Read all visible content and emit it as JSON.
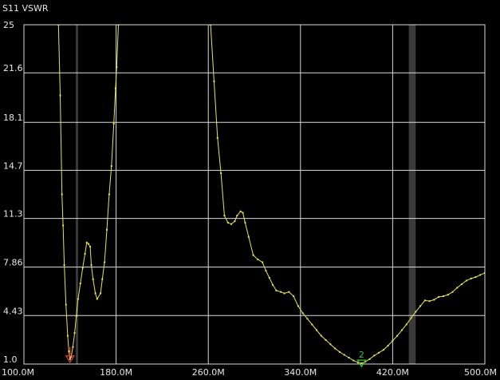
{
  "window": {
    "title": "S11 VSWR"
  },
  "colors": {
    "background": "#000000",
    "grid": "#d9d9d9",
    "axis_text": "#e6e6e6",
    "trace": "#e8e35a",
    "band": "#3a3a3a",
    "marker1": "#e03a3a",
    "marker2": "#3cbe3c"
  },
  "chart_data": {
    "type": "line",
    "title": "S11 VSWR",
    "xlabel": "",
    "ylabel": "",
    "x_unit": "Hz",
    "xlim": [
      100000000,
      500000000
    ],
    "ylim": [
      1.0,
      25
    ],
    "x_ticks": [
      {
        "value": 100000000,
        "label": "100.0M"
      },
      {
        "value": 180000000,
        "label": "180.0M"
      },
      {
        "value": 260000000,
        "label": "260.0M"
      },
      {
        "value": 340000000,
        "label": "340.0M"
      },
      {
        "value": 420000000,
        "label": "420.0M"
      },
      {
        "value": 500000000,
        "label": "500.0M"
      }
    ],
    "y_ticks": [
      {
        "value": 1.0,
        "label": "1.0"
      },
      {
        "value": 4.43,
        "label": "4.43"
      },
      {
        "value": 7.86,
        "label": "7.86"
      },
      {
        "value": 11.3,
        "label": "11.3"
      },
      {
        "value": 14.7,
        "label": "14.7"
      },
      {
        "value": 18.1,
        "label": "18.1"
      },
      {
        "value": 21.6,
        "label": "21.6"
      },
      {
        "value": 25,
        "label": "25"
      }
    ],
    "grid": true,
    "bands": [
      {
        "x0": 145000000,
        "x1": 147000000
      },
      {
        "x0": 434000000,
        "x1": 440000000
      }
    ],
    "series": [
      {
        "points": [
          [
            130000000,
            25
          ],
          [
            131500000,
            20
          ],
          [
            133000000,
            13
          ],
          [
            134000000,
            10.8
          ],
          [
            135000000,
            8.0
          ],
          [
            136500000,
            5.2
          ],
          [
            138000000,
            3.0
          ],
          [
            139000000,
            1.9
          ],
          [
            140000000,
            1.35
          ],
          [
            141000000,
            1.5
          ],
          [
            142500000,
            2.2
          ],
          [
            144000000,
            3.2
          ],
          [
            145500000,
            4.4
          ],
          [
            147000000,
            5.6
          ],
          [
            149000000,
            6.7
          ],
          [
            151000000,
            7.8
          ],
          [
            153000000,
            8.8
          ],
          [
            154500000,
            9.6
          ],
          [
            156000000,
            9.5
          ],
          [
            157500000,
            9.3
          ],
          [
            158500000,
            8.0
          ],
          [
            160000000,
            7.0
          ],
          [
            162000000,
            6.0
          ],
          [
            163500000,
            5.6
          ],
          [
            166500000,
            6.0
          ],
          [
            168000000,
            7.0
          ],
          [
            170000000,
            8.2
          ],
          [
            172000000,
            10.5
          ],
          [
            174000000,
            13.0
          ],
          [
            176000000,
            15.0
          ],
          [
            178000000,
            18.0
          ],
          [
            179500000,
            20.5
          ],
          [
            180500000,
            22.0
          ],
          [
            182000000,
            25
          ],
          [
            262000000,
            25
          ],
          [
            265000000,
            21.0
          ],
          [
            268000000,
            17.0
          ],
          [
            271000000,
            14.5
          ],
          [
            274000000,
            11.5
          ],
          [
            277000000,
            11.0
          ],
          [
            280000000,
            10.9
          ],
          [
            283000000,
            11.1
          ],
          [
            285000000,
            11.5
          ],
          [
            288000000,
            11.8
          ],
          [
            290000000,
            11.7
          ],
          [
            292000000,
            11.0
          ],
          [
            295000000,
            10.0
          ],
          [
            299000000,
            8.7
          ],
          [
            303000000,
            8.4
          ],
          [
            307000000,
            8.2
          ],
          [
            310000000,
            7.6
          ],
          [
            313000000,
            7.1
          ],
          [
            316000000,
            6.6
          ],
          [
            319000000,
            6.2
          ],
          [
            323000000,
            6.1
          ],
          [
            326000000,
            6.0
          ],
          [
            330000000,
            6.1
          ],
          [
            334000000,
            5.8
          ],
          [
            338000000,
            5.1
          ],
          [
            342000000,
            4.6
          ],
          [
            346000000,
            4.2
          ],
          [
            350000000,
            3.8
          ],
          [
            354000000,
            3.4
          ],
          [
            358000000,
            3.0
          ],
          [
            362000000,
            2.7
          ],
          [
            366000000,
            2.4
          ],
          [
            370000000,
            2.1
          ],
          [
            374000000,
            1.85
          ],
          [
            378000000,
            1.65
          ],
          [
            382000000,
            1.45
          ],
          [
            386000000,
            1.25
          ],
          [
            390000000,
            1.1
          ],
          [
            393000000,
            1.05
          ],
          [
            396000000,
            1.15
          ],
          [
            400000000,
            1.35
          ],
          [
            404000000,
            1.6
          ],
          [
            408000000,
            1.8
          ],
          [
            412000000,
            2.0
          ],
          [
            416000000,
            2.3
          ],
          [
            420000000,
            2.65
          ],
          [
            424000000,
            3.0
          ],
          [
            428000000,
            3.4
          ],
          [
            432000000,
            3.8
          ],
          [
            436000000,
            4.25
          ],
          [
            440000000,
            4.7
          ],
          [
            444000000,
            5.1
          ],
          [
            448000000,
            5.5
          ],
          [
            452000000,
            5.45
          ],
          [
            456000000,
            5.55
          ],
          [
            460000000,
            5.75
          ],
          [
            464000000,
            5.8
          ],
          [
            468000000,
            5.9
          ],
          [
            472000000,
            6.1
          ],
          [
            476000000,
            6.4
          ],
          [
            480000000,
            6.65
          ],
          [
            484000000,
            6.9
          ],
          [
            488000000,
            7.05
          ],
          [
            492000000,
            7.15
          ],
          [
            496000000,
            7.3
          ],
          [
            500000000,
            7.45
          ]
        ]
      }
    ],
    "markers": [
      {
        "label": "1",
        "x": 140000000,
        "y": 1.35,
        "color": "#e03a3a"
      },
      {
        "label": "2",
        "x": 393000000,
        "y": 1.05,
        "color": "#3cbe3c"
      }
    ]
  }
}
